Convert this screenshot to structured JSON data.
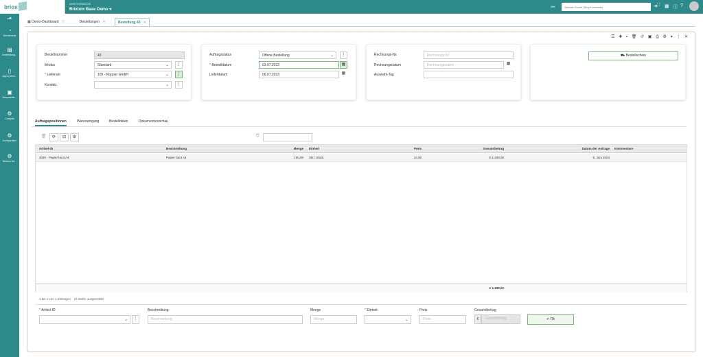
{
  "app": {
    "logo": "briox",
    "tenant_id": "#4867098383245",
    "tenant_name": "Brixbox Base Demo",
    "search_label": "Alle",
    "search_placeholder": "Globale Suche (Strg+Leertaste)"
  },
  "sidebar": {
    "items": [
      {
        "label": "Dashboards",
        "icon": "dashboard-icon"
      },
      {
        "label": "Anwendung...",
        "icon": "application-icon"
      },
      {
        "label": "Apps (Admi...",
        "icon": "tablet-icon"
      },
      {
        "label": "Dokumente...",
        "icon": "document-icon"
      },
      {
        "label": "Cockpits",
        "icon": "cockpit-icon"
      },
      {
        "label": "Konfiguration",
        "icon": "config-icon"
      },
      {
        "label": "Brixbox Ad...",
        "icon": "admin-icon"
      }
    ]
  },
  "tabs": [
    {
      "label": "Demo-Dashboard"
    },
    {
      "label": "Bestellungen"
    },
    {
      "label": "Bestellung 43"
    }
  ],
  "form": {
    "bestellnummer_label": "Bestellnummer",
    "bestellnummer_value": "43",
    "modus_label": "Modus",
    "modus_value": "Standard",
    "lieferant_label": "Lieferant",
    "lieferant_value": "105 - Nopper GmbH",
    "kontakt_label": "Kontakt",
    "kontakt_value": "",
    "auftragsstatus_label": "Auftragsstatus",
    "auftragsstatus_value": "Offene Bestellung",
    "bestelldatum_label": "Bestelldatum",
    "bestelldatum_value": "03.07.2023",
    "lieferdatum_label": "Lieferdatum",
    "lieferdatum_value": "06.07.2023",
    "rechnungsnr_label": "Rechnungs-Nr.",
    "rechnungsnr_placeholder": "Rechnungs-Nr.",
    "rechnungsdatum_label": "Rechnungsdatum",
    "rechnungsdatum_placeholder": "Rechnungsdatum",
    "auswahltag_label": "Auswahl-Tag",
    "bestellschein_label": "Bestellschein"
  },
  "section_tabs": [
    {
      "label": "Auftragspositionen"
    },
    {
      "label": "Wareneingang"
    },
    {
      "label": "Bestelldaten"
    },
    {
      "label": "Dokumentvorschau"
    }
  ],
  "grid": {
    "columns": [
      "Artikel-ID",
      "Beschreibung",
      "Menge",
      "Einheit",
      "Preis",
      "Gesamtbetrag",
      "Datum der Anfrage",
      "Kommentare"
    ],
    "rows": [
      [
        "4025 - Papier bunt A4",
        "Papier bunt A4",
        "100,00",
        "Stk / Stück",
        "12,00",
        "€ 1.200,00",
        "9. Juni 2023",
        ""
      ]
    ],
    "total": "€ 1.200,00",
    "pager": "1 bis 1 von 1 Einträgen",
    "selected": "(0 Zeilen ausgewählt)"
  },
  "entry": {
    "artikel_label": "Artikel-ID",
    "beschreibung_label": "Beschreibung",
    "beschreibung_placeholder": "Beschreibung",
    "menge_label": "Menge",
    "menge_placeholder": "Menge",
    "einheit_label": "Einheit",
    "preis_label": "Preis",
    "preis_placeholder": "Preis",
    "gesamt_label": "Gesamtbetrag",
    "gesamt_placeholder": "Gesamtbetrag",
    "currency": "€",
    "ok_label": "Ok"
  }
}
